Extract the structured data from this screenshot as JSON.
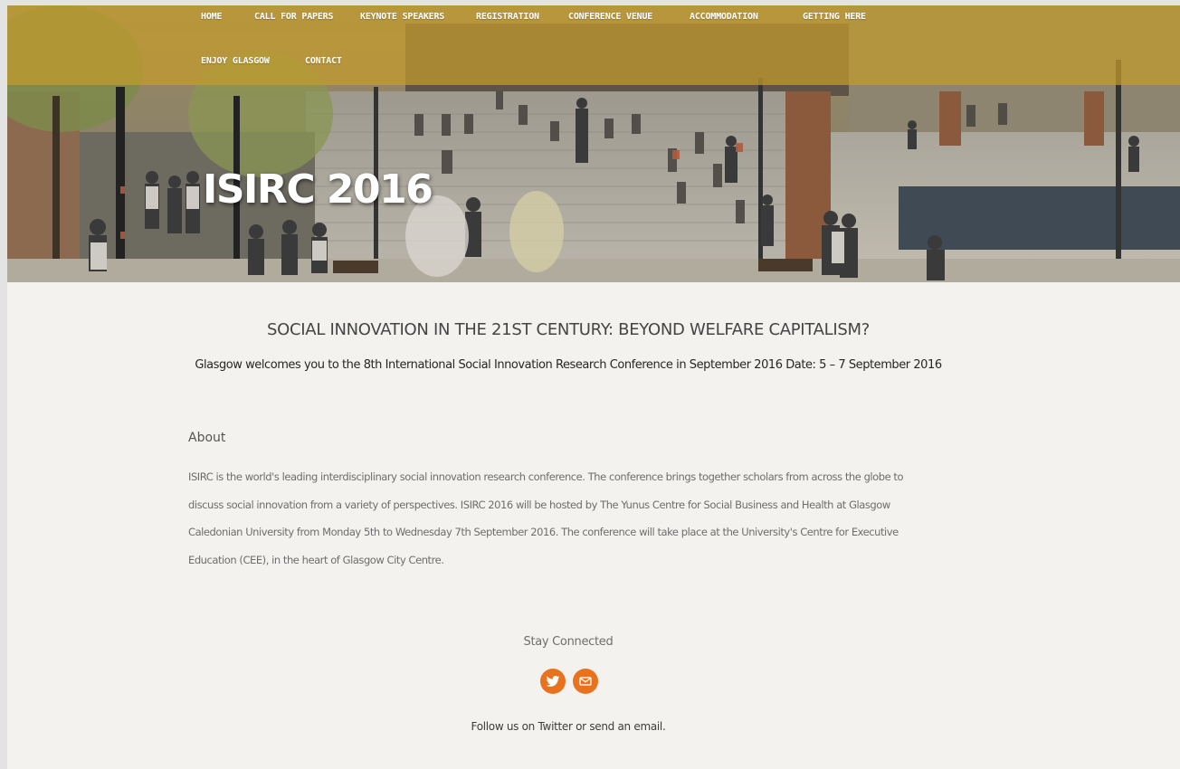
{
  "nav": {
    "items": [
      {
        "label": "HOME"
      },
      {
        "label": "CALL FOR PAPERS"
      },
      {
        "label": "KEYNOTE SPEAKERS"
      },
      {
        "label": "REGISTRATION"
      },
      {
        "label": "CONFERENCE VENUE"
      },
      {
        "label": "ACCOMMODATION"
      },
      {
        "label": "GETTING HERE"
      },
      {
        "label": "ENJOY GLASGOW"
      },
      {
        "label": "CONTACT"
      }
    ]
  },
  "hero": {
    "title": "ISIRC 2016"
  },
  "main": {
    "headline": "SOCIAL INNOVATION IN THE 21ST CENTURY: BEYOND WELFARE CAPITALISM?",
    "subheadline": "Glasgow welcomes you to the 8th International Social Innovation Research Conference in September 2016 Date: 5 – 7 September 2016",
    "about_heading": "About",
    "about_text": "ISIRC is the world's leading interdisciplinary social innovation research conference.  The conference brings together scholars from across the globe to discuss social innovation from a variety of perspectives. ISIRC 2016  will be hosted by The Yunus Centre for Social Business and Health at Glasgow Caledonian University from Monday 5th to Wednesday 7th September 2016. The conference will take place at the University's Centre for Executive Education (CEE), in the heart of Glasgow City Centre."
  },
  "footer": {
    "stay_connected": "Stay Connected",
    "social": [
      {
        "icon": "twitter-icon"
      },
      {
        "icon": "email-icon"
      }
    ],
    "follow_text": "Follow us on Twitter or send an email."
  },
  "colors": {
    "accent": "#e8721e",
    "nav_bar": "#c39b2d",
    "page_background": "#f3f2ee"
  }
}
